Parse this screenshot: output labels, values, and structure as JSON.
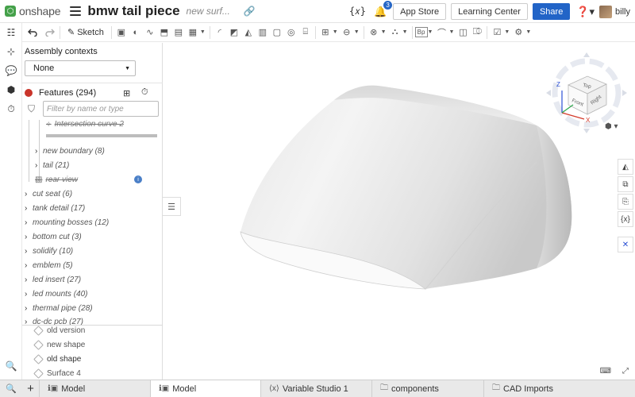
{
  "app": {
    "logo_text": "onshape",
    "document_title": "bmw tail piece",
    "document_subtitle": "new surf...",
    "notifications_count": "3",
    "app_store_label": "App Store",
    "learning_center_label": "Learning Center",
    "share_label": "Share",
    "user_name": "billy",
    "variables_icon_text": "{𝑥}"
  },
  "toolbar": {
    "sketch_label": "Sketch"
  },
  "panel": {
    "assembly_contexts_label": "Assembly contexts",
    "assembly_contexts_value": "None",
    "features_title": "Features (294)",
    "filter_placeholder": "Filter by name or type",
    "tree_items": [
      "Intersection curve 2",
      "new boundary (8)",
      "tail (21)",
      "rear view",
      "cut seat (6)",
      "tank detail (17)",
      "mounting bosses (12)",
      "bottom cut (3)",
      "solidify (10)",
      "emblem (5)",
      "led insert (27)",
      "led mounts (40)",
      "thermal pipe (28)",
      "dc-dc pcb (27)"
    ],
    "parts": [
      "old version",
      "new shape",
      "old shape",
      "Surface 4"
    ]
  },
  "viewcube": {
    "top": "Top",
    "front": "Front",
    "right": "Right",
    "axis_x": "X",
    "axis_z": "Z"
  },
  "tabs": [
    {
      "label": "Model",
      "active": false
    },
    {
      "label": "Model",
      "active": true
    },
    {
      "label": "Variable Studio 1",
      "active": false
    },
    {
      "label": "components",
      "active": false
    },
    {
      "label": "CAD Imports",
      "active": false
    }
  ],
  "colors": {
    "brand_green": "#45a14a",
    "share_blue": "#2264c7",
    "feature_error_red": "#c9342a"
  }
}
